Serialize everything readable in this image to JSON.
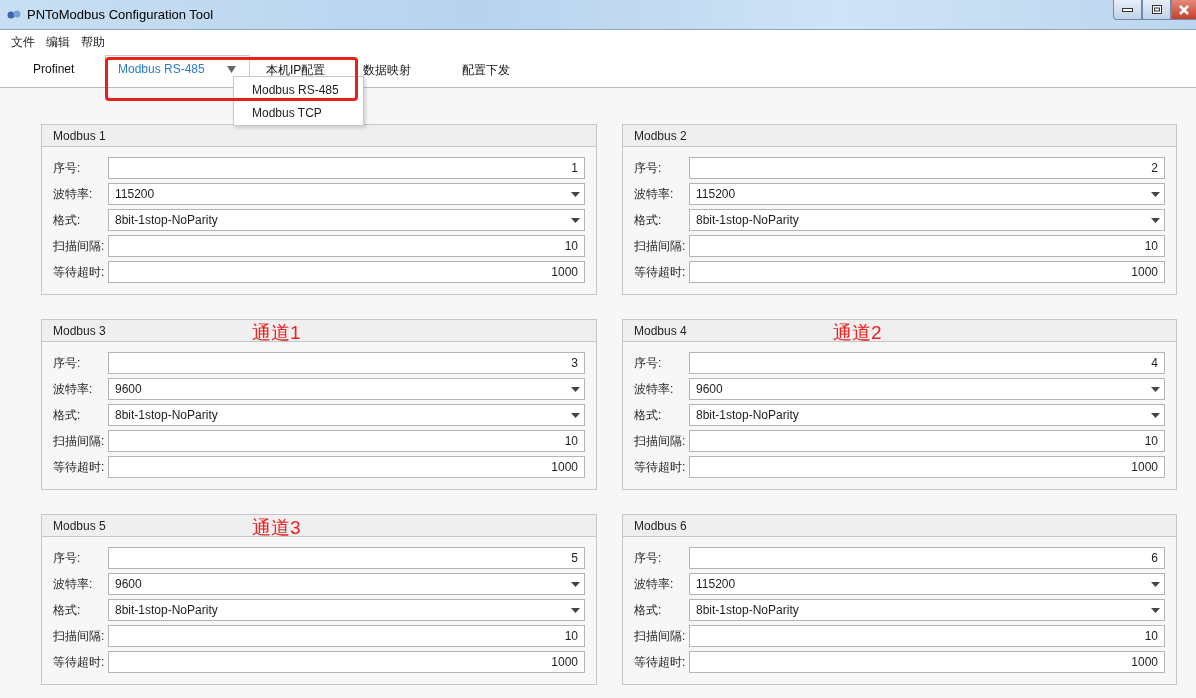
{
  "window": {
    "title": "PNToModbus Configuration Tool"
  },
  "menu_bar": [
    "文件",
    "编辑",
    "帮助"
  ],
  "tabs": [
    {
      "label": "Profinet",
      "selected": false,
      "kind": "plain"
    },
    {
      "label": "Modbus RS-485",
      "selected": true,
      "kind": "dropdown"
    },
    {
      "label": "本机IP配置",
      "selected": false,
      "kind": "plain"
    },
    {
      "label": "数据映射",
      "selected": false,
      "kind": "plain"
    },
    {
      "label": "配置下发",
      "selected": false,
      "kind": "plain"
    }
  ],
  "dropdown_menu": {
    "items": [
      "Modbus RS-485",
      "Modbus TCP"
    ]
  },
  "groups": [
    {
      "title": "Modbus 1",
      "fields": [
        {
          "label": "序号:",
          "value": "1",
          "kind": "text"
        },
        {
          "label": "波特率:",
          "value": "115200",
          "kind": "combo"
        },
        {
          "label": "格式:",
          "value": "8bit-1stop-NoParity",
          "kind": "combo"
        },
        {
          "label": "扫描间隔:",
          "value": "10",
          "kind": "text"
        },
        {
          "label": "等待超时:",
          "value": "1000",
          "kind": "text"
        }
      ]
    },
    {
      "title": "Modbus 2",
      "fields": [
        {
          "label": "序号:",
          "value": "2",
          "kind": "text"
        },
        {
          "label": "波特率:",
          "value": "115200",
          "kind": "combo"
        },
        {
          "label": "格式:",
          "value": "8bit-1stop-NoParity",
          "kind": "combo"
        },
        {
          "label": "扫描间隔:",
          "value": "10",
          "kind": "text"
        },
        {
          "label": "等待超时:",
          "value": "1000",
          "kind": "text"
        }
      ]
    },
    {
      "title": "Modbus 3",
      "annotation": "通道1",
      "fields": [
        {
          "label": "序号:",
          "value": "3",
          "kind": "text"
        },
        {
          "label": "波特率:",
          "value": "9600",
          "kind": "combo"
        },
        {
          "label": "格式:",
          "value": "8bit-1stop-NoParity",
          "kind": "combo"
        },
        {
          "label": "扫描间隔:",
          "value": "10",
          "kind": "text"
        },
        {
          "label": "等待超时:",
          "value": "1000",
          "kind": "text"
        }
      ]
    },
    {
      "title": "Modbus 4",
      "annotation": "通道2",
      "fields": [
        {
          "label": "序号:",
          "value": "4",
          "kind": "text"
        },
        {
          "label": "波特率:",
          "value": "9600",
          "kind": "combo"
        },
        {
          "label": "格式:",
          "value": "8bit-1stop-NoParity",
          "kind": "combo"
        },
        {
          "label": "扫描间隔:",
          "value": "10",
          "kind": "text"
        },
        {
          "label": "等待超时:",
          "value": "1000",
          "kind": "text"
        }
      ]
    },
    {
      "title": "Modbus 5",
      "annotation": "通道3",
      "fields": [
        {
          "label": "序号:",
          "value": "5",
          "kind": "text"
        },
        {
          "label": "波特率:",
          "value": "9600",
          "kind": "combo"
        },
        {
          "label": "格式:",
          "value": "8bit-1stop-NoParity",
          "kind": "combo"
        },
        {
          "label": "扫描间隔:",
          "value": "10",
          "kind": "text"
        },
        {
          "label": "等待超时:",
          "value": "1000",
          "kind": "text"
        }
      ]
    },
    {
      "title": "Modbus 6",
      "fields": [
        {
          "label": "序号:",
          "value": "6",
          "kind": "text"
        },
        {
          "label": "波特率:",
          "value": "115200",
          "kind": "combo"
        },
        {
          "label": "格式:",
          "value": "8bit-1stop-NoParity",
          "kind": "combo"
        },
        {
          "label": "扫描间隔:",
          "value": "10",
          "kind": "text"
        },
        {
          "label": "等待超时:",
          "value": "1000",
          "kind": "text"
        }
      ]
    }
  ]
}
